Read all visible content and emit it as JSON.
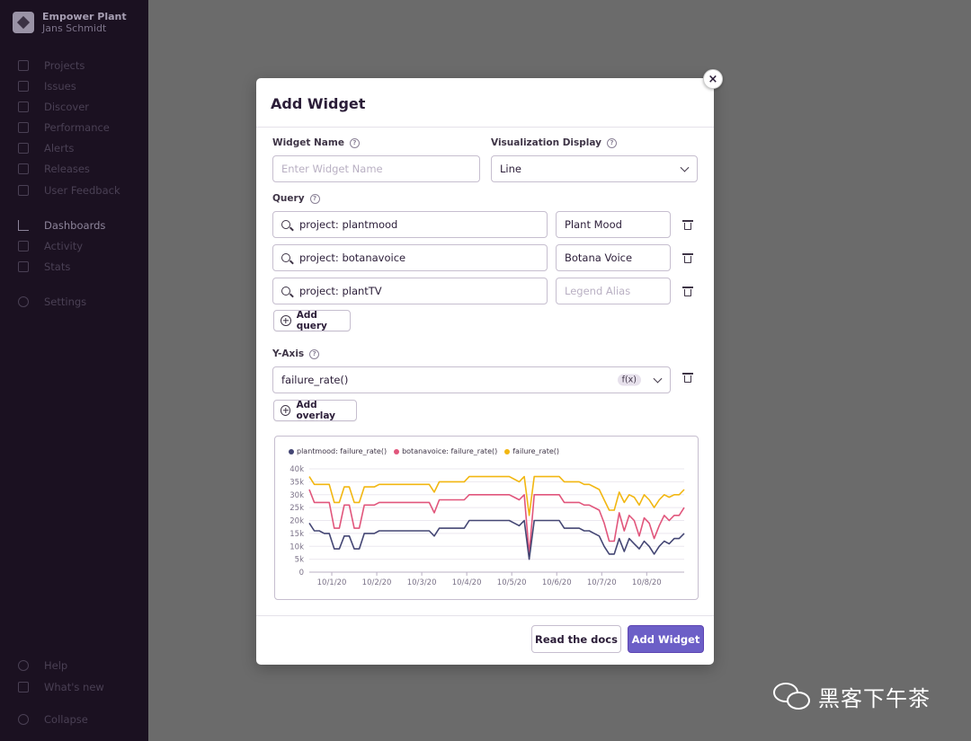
{
  "sidebar": {
    "org_name": "Empower Plant",
    "user_name": "Jans Schmidt",
    "items": [
      {
        "label": "Projects"
      },
      {
        "label": "Issues"
      },
      {
        "label": "Discover"
      },
      {
        "label": "Performance"
      },
      {
        "label": "Alerts"
      },
      {
        "label": "Releases"
      },
      {
        "label": "User Feedback"
      },
      {
        "label": "Dashboards"
      },
      {
        "label": "Activity"
      },
      {
        "label": "Stats"
      },
      {
        "label": "Settings"
      },
      {
        "label": "Help"
      },
      {
        "label": "What's new"
      },
      {
        "label": "Collapse"
      }
    ],
    "active_item": "Dashboards"
  },
  "modal": {
    "title": "Add Widget",
    "close_icon": "×",
    "widget_name_label": "Widget Name",
    "widget_name_placeholder": "Enter Widget Name",
    "visualization_label": "Visualization Display",
    "visualization_value": "Line",
    "query_label": "Query",
    "queries": [
      {
        "query": "project: plantmood",
        "alias": "Plant Mood",
        "alias_placeholder": ""
      },
      {
        "query": "project: botanavoice",
        "alias": "Botana Voice",
        "alias_placeholder": ""
      },
      {
        "query": "project: plantTV",
        "alias": "",
        "alias_placeholder": "Legend Alias"
      }
    ],
    "add_query_label": "Add query",
    "yaxis_label": "Y-Axis",
    "yaxis_value": "failure_rate()",
    "fx_badge": "f(x)",
    "add_overlay_label": "Add overlay",
    "read_docs_label": "Read the docs",
    "add_widget_label": "Add Widget",
    "help_glyph": "?"
  },
  "colors": {
    "accent": "#6c5fc7",
    "series_plantmood": "#444674",
    "series_botanavoice": "#e1567c",
    "series_failure": "#f2b712"
  },
  "chart_data": {
    "type": "line",
    "title": "",
    "xlabel": "",
    "ylabel": "",
    "ylim": [
      0,
      40000
    ],
    "y_ticks": [
      "0",
      "5k",
      "10k",
      "15k",
      "20k",
      "25k",
      "30k",
      "35k",
      "40k"
    ],
    "x_ticks": [
      "10/1/20",
      "10/2/20",
      "10/3/20",
      "10/4/20",
      "10/5/20",
      "10/6/20",
      "10/7/20",
      "10/8/20"
    ],
    "x_domain": [
      "9/30/20 12:00",
      "10/8/20 20:00"
    ],
    "grid": true,
    "legend_position": "top-left",
    "series": [
      {
        "name": "plantmood: failure_rate()",
        "color": "#444674",
        "values": [
          19000,
          16000,
          16000,
          15000,
          15000,
          9000,
          9000,
          14000,
          14000,
          9000,
          9000,
          15000,
          15000,
          15000,
          16000,
          16000,
          16000,
          16000,
          16000,
          16000,
          16000,
          16000,
          16000,
          16000,
          16000,
          14000,
          17000,
          17000,
          17000,
          17000,
          17000,
          17000,
          20000,
          20000,
          20000,
          20000,
          20000,
          20000,
          20000,
          20000,
          20000,
          19000,
          18000,
          20000,
          5000,
          20000,
          20000,
          20000,
          20000,
          20000,
          20000,
          17000,
          17000,
          17000,
          17000,
          16000,
          16000,
          15000,
          14000,
          10000,
          7000,
          7000,
          13000,
          8000,
          13000,
          11000,
          9000,
          12000,
          10000,
          7000,
          10000,
          12000,
          11000,
          13000,
          13000,
          15000
        ]
      },
      {
        "name": "botanavoice: failure_rate()",
        "color": "#e1567c",
        "values": [
          32000,
          27000,
          27000,
          27000,
          27000,
          17000,
          17000,
          26000,
          26000,
          17000,
          17000,
          26000,
          26000,
          26000,
          27000,
          27000,
          27000,
          27000,
          27000,
          27000,
          27000,
          27000,
          27000,
          27000,
          27000,
          23000,
          28000,
          28000,
          28000,
          28000,
          28000,
          28000,
          30000,
          30000,
          30000,
          30000,
          30000,
          30000,
          30000,
          30000,
          30000,
          29000,
          28000,
          30000,
          7000,
          30000,
          30000,
          30000,
          30000,
          30000,
          30000,
          27000,
          27000,
          27000,
          27000,
          26000,
          26000,
          25000,
          24000,
          19000,
          12000,
          12000,
          23000,
          16000,
          22000,
          20000,
          14000,
          21000,
          19000,
          13000,
          18000,
          22000,
          20000,
          22000,
          22000,
          25000
        ]
      },
      {
        "name": "failure_rate()",
        "color": "#f2b712",
        "values": [
          37000,
          34000,
          34000,
          34000,
          34000,
          27000,
          27000,
          33000,
          33000,
          27000,
          27000,
          33000,
          33000,
          33000,
          34000,
          34000,
          34000,
          34000,
          34000,
          34000,
          34000,
          34000,
          34000,
          34000,
          34000,
          31000,
          35000,
          35000,
          35000,
          35000,
          35000,
          35000,
          37000,
          37000,
          37000,
          37000,
          37000,
          37000,
          37000,
          37000,
          37000,
          36000,
          35000,
          37000,
          22000,
          37000,
          37000,
          37000,
          37000,
          37000,
          37000,
          35000,
          35000,
          35000,
          35000,
          34000,
          34000,
          33000,
          32000,
          28000,
          24000,
          24000,
          31000,
          27000,
          30000,
          29000,
          26000,
          30000,
          28000,
          25000,
          28000,
          30000,
          29000,
          30000,
          30000,
          32000
        ]
      }
    ]
  },
  "watermark": {
    "text": "黑客下午茶"
  }
}
